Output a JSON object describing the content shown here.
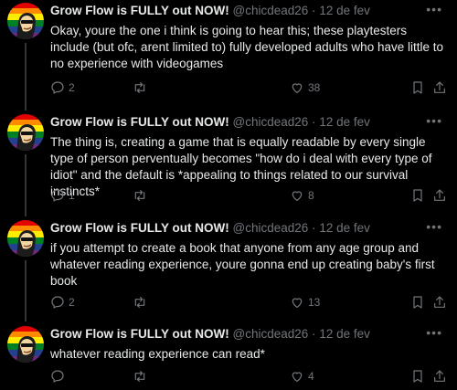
{
  "author": {
    "display_name": "Grow Flow is FULLY out NOW!",
    "handle": "@chicdead26",
    "separator": "·"
  },
  "tweets": [
    {
      "date": "12 de fev",
      "text": "Okay, youre the one i think is going to hear this; these playtesters include (but ofc, arent limited to) fully developed adults who have little to no experience with videogames",
      "replies": "2",
      "retweets": "",
      "likes": "38"
    },
    {
      "date": "12 de fev",
      "text": "The thing is, creating a game that is equally readable by every single type of person perventually becomes \"how do i deal with every type of idiot\" and the default is *appealing to things related to our survival instincts*",
      "replies": "1",
      "retweets": "",
      "likes": "8"
    },
    {
      "date": "12 de fev",
      "text": "if you attempt to create a book that anyone from any age group and whatever reading experience, youre gonna end up creating baby's first book",
      "replies": "2",
      "retweets": "",
      "likes": "13"
    },
    {
      "date": "12 de fev",
      "text": "whatever reading experience can read*",
      "replies": "",
      "retweets": "",
      "likes": "4"
    }
  ],
  "icons": {
    "reply": "reply-icon",
    "retweet": "retweet-icon",
    "like": "heart-icon",
    "bookmark": "bookmark-icon",
    "share": "share-icon",
    "more": "more-icon"
  },
  "colors": {
    "background": "#000000",
    "text": "#e7e9ea",
    "muted": "#71767b",
    "thread_line": "#333639"
  }
}
